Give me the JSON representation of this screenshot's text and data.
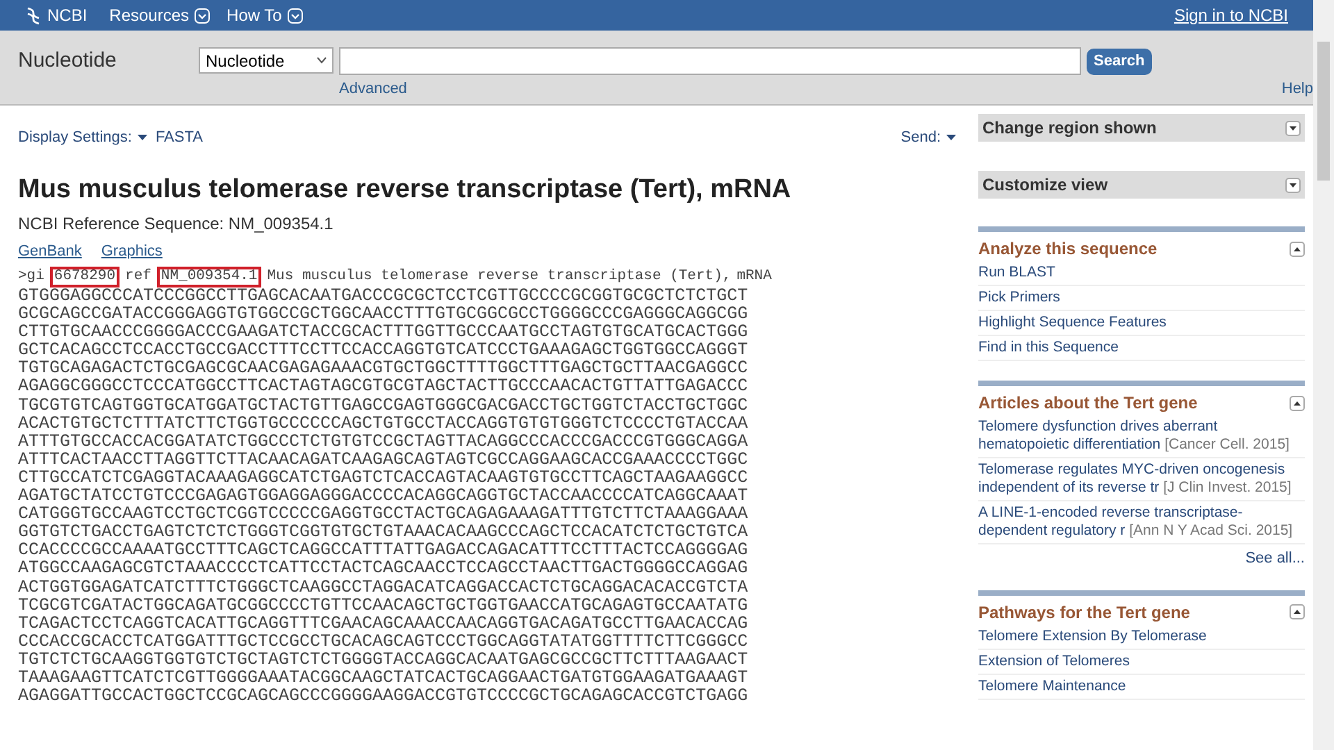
{
  "topbar": {
    "logo": "NCBI",
    "menus": [
      "Resources",
      "How To"
    ],
    "signin": "Sign in to NCBI"
  },
  "search": {
    "db_label": "Nucleotide",
    "db_select": "Nucleotide",
    "button": "Search",
    "advanced": "Advanced",
    "help": "Help"
  },
  "display": {
    "settings": "Display Settings:",
    "format": "FASTA",
    "send": "Send:"
  },
  "record": {
    "title": "Mus musculus telomerase reverse transcriptase (Tert), mRNA",
    "refseq": "NCBI Reference Sequence: NM_009354.1",
    "links": [
      "GenBank",
      "Graphics"
    ],
    "defline": [
      {
        "text": ">gi",
        "highlighted": false
      },
      {
        "text": "6678290",
        "highlighted": true
      },
      {
        "text": "ref",
        "highlighted": false
      },
      {
        "text": "NM_009354.1",
        "highlighted": true
      },
      {
        "text": "Mus musculus telomerase reverse transcriptase (Tert),",
        "highlighted": false
      },
      {
        "text": "mRNA",
        "highlighted": false
      }
    ],
    "sequence": [
      "GTGGGAGGCCCATCCCGGCCTTGAGCACAATGACCCGCGCTCCTCGTTGCCCCGCGGTGCGCTCTCTGCT",
      "GCGCAGCCGATACCGGGAGGTGTGGCCGCTGGCAACCTTTGTGCGGCGCCTGGGGCCCGAGGGCAGGCGG",
      "CTTGTGCAACCCGGGGACCCGAAGATCTACCGCACTTTGGTTGCCCAATGCCTAGTGTGCATGCACTGGG",
      "GCTCACAGCCTCCACCTGCCGACCTTTCCTTCCACCAGGTGTCATCCCTGAAAGAGCTGGTGGCCAGGGT",
      "TGTGCAGAGACTCTGCGAGCGCAACGAGAGAAACGTGCTGGCTTTTGGCTTTGAGCTGCTTAACGAGGCC",
      "AGAGGCGGGCCTCCCATGGCCTTCACTAGTAGCGTGCGTAGCTACTTGCCCAACACTGTTATTGAGACCC",
      "TGCGTGTCAGTGGTGCATGGATGCTACTGTTGAGCCGAGTGGGCGACGACCTGCTGGTCTACCTGCTGGC",
      "ACACTGTGCTCTTTATCTTCTGGTGCCCCCCAGCTGTGCCTACCAGGTGTGTGGGTCTCCCCTGTACCAA",
      "ATTTGTGCCACCACGGATATCTGGCCCTCTGTGTCCGCTAGTTACAGGCCCACCCGACCCGTGGGCAGGA",
      "ATTTCACTAACCTTAGGTTCTTACAACAGATCAAGAGCAGTAGTCGCCAGGAAGCACCGAAACCCCTGGC",
      "CTTGCCATCTCGAGGTACAAAGAGGCATCTGAGTCTCACCAGTACAAGTGTGCCTTCAGCTAAGAAGGCC",
      "AGATGCTATCCTGTCCCGAGAGTGGAGGAGGGACCCCACAGGCAGGTGCTACCAACCCCATCAGGCAAAT",
      "CATGGGTGCCAAGTCCTGCTCGGTCCCCCGAGGTGCCTACTGCAGAGAAAGATTTGTCTTCTAAAGGAAA",
      "GGTGTCTGACCTGAGTCTCTCTGGGTCGGTGTGCTGTAAACACAAGCCCAGCTCCACATCTCTGCTGTCA",
      "CCACCCCGCCAAAATGCCTTTCAGCTCAGGCCATTTATTGAGACCAGACATTTCCTTTACTCCAGGGGAG",
      "ATGGCCAAGAGCGTCTAAACCCCTCATTCCTACTCAGCAACCTCCAGCCTAACTTGACTGGGGCCAGGAG",
      "ACTGGTGGAGATCATCTTTCTGGGCTCAAGGCCTAGGACATCAGGACCACTCTGCAGGACACACCGTCTA",
      "TCGCGTCGATACTGGCAGATGCGGCCCCTGTTCCAACAGCTGCTGGTGAACCATGCAGAGTGCCAATATG",
      "TCAGACTCCTCAGGTCACATTGCAGGTTTCGAACAGCAAACCAACAGGTGACAGATGCCTTGAACACCAG",
      "CCCACCGCACCTCATGGATTTGCTCCGCCTGCACAGCAGTCCCTGGCAGGTATATGGTTTTCTTCGGGCC",
      "TGTCTCTGCAAGGTGGTGTCTGCTAGTCTCTGGGGTACCAGGCACAATGAGCGCCGCTTCTTTAAGAACT",
      "TAAAGAAGTTCATCTCGTTGGGGAAATACGGCAAGCTATCACTGCAGGAACTGATGTGGAAGATGAAAGT",
      "AGAGGATTGCCACTGGCTCCGCAGCAGCCCGGGGAAGGACCGTGTCCCCGCTGCAGAGCACCGTCTGAGG"
    ]
  },
  "sidebar": [
    {
      "kind": "bar",
      "title": "Change region shown",
      "expanded": false
    },
    {
      "kind": "bar",
      "title": "Customize view",
      "expanded": false
    },
    {
      "kind": "portal",
      "title": "Analyze this sequence",
      "expanded": true,
      "items": [
        {
          "text": "Run BLAST"
        },
        {
          "text": "Pick Primers"
        },
        {
          "text": "Highlight Sequence Features"
        },
        {
          "text": "Find in this Sequence"
        }
      ]
    },
    {
      "kind": "portal",
      "title": "Articles about the Tert gene",
      "expanded": true,
      "items": [
        {
          "text": "Telomere dysfunction drives aberrant hematopoietic differentiation",
          "source": "[Cancer Cell. 2015]"
        },
        {
          "text": "Telomerase regulates MYC-driven oncogenesis independent of its reverse tr",
          "source": "[J Clin Invest. 2015]"
        },
        {
          "text": "A LINE-1-encoded reverse transcriptase-dependent regulatory r",
          "source": "[Ann N Y Acad Sci. 2015]"
        }
      ],
      "more": "See all..."
    },
    {
      "kind": "portal",
      "title": "Pathways for the Tert gene",
      "expanded": true,
      "items": [
        {
          "text": "Telomere Extension By Telomerase"
        },
        {
          "text": "Extension of Telomeres"
        },
        {
          "text": "Telomere Maintenance"
        }
      ]
    }
  ]
}
